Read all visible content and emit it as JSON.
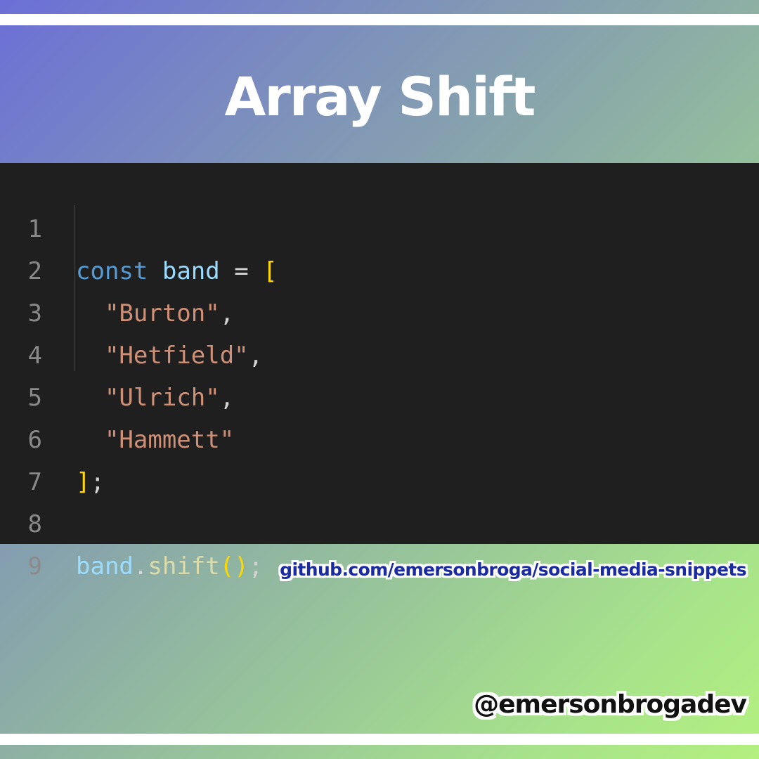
{
  "title": "Array Shift",
  "code": {
    "lines": [
      {
        "number": "1",
        "tokens": [
          "const",
          "band",
          "=",
          "["
        ]
      },
      {
        "number": "2",
        "tokens": [
          "\"Burton\"",
          ","
        ]
      },
      {
        "number": "3",
        "tokens": [
          "\"Hetfield\"",
          ","
        ]
      },
      {
        "number": "4",
        "tokens": [
          "\"Ulrich\"",
          ","
        ]
      },
      {
        "number": "5",
        "tokens": [
          "\"Hammett\""
        ]
      },
      {
        "number": "6",
        "tokens": [
          "]",
          ";"
        ]
      },
      {
        "number": "7",
        "tokens": []
      },
      {
        "number": "8",
        "tokens": [
          "band",
          ".",
          "shift",
          "()",
          ";"
        ]
      },
      {
        "number": "9",
        "tokens": []
      }
    ]
  },
  "footer": {
    "github_url": "github.com/emersonbroga/social-media-snippets",
    "handle": "@emersonbrogadev"
  },
  "colors": {
    "gradient_start": "#6b6fd6",
    "gradient_end": "#b3f07f",
    "editor_bg": "#1f1f1f",
    "keyword": "#569cd6",
    "identifier": "#9cdcfe",
    "string": "#ce9178",
    "bracket": "#ffd700",
    "function": "#dcdcaa"
  }
}
